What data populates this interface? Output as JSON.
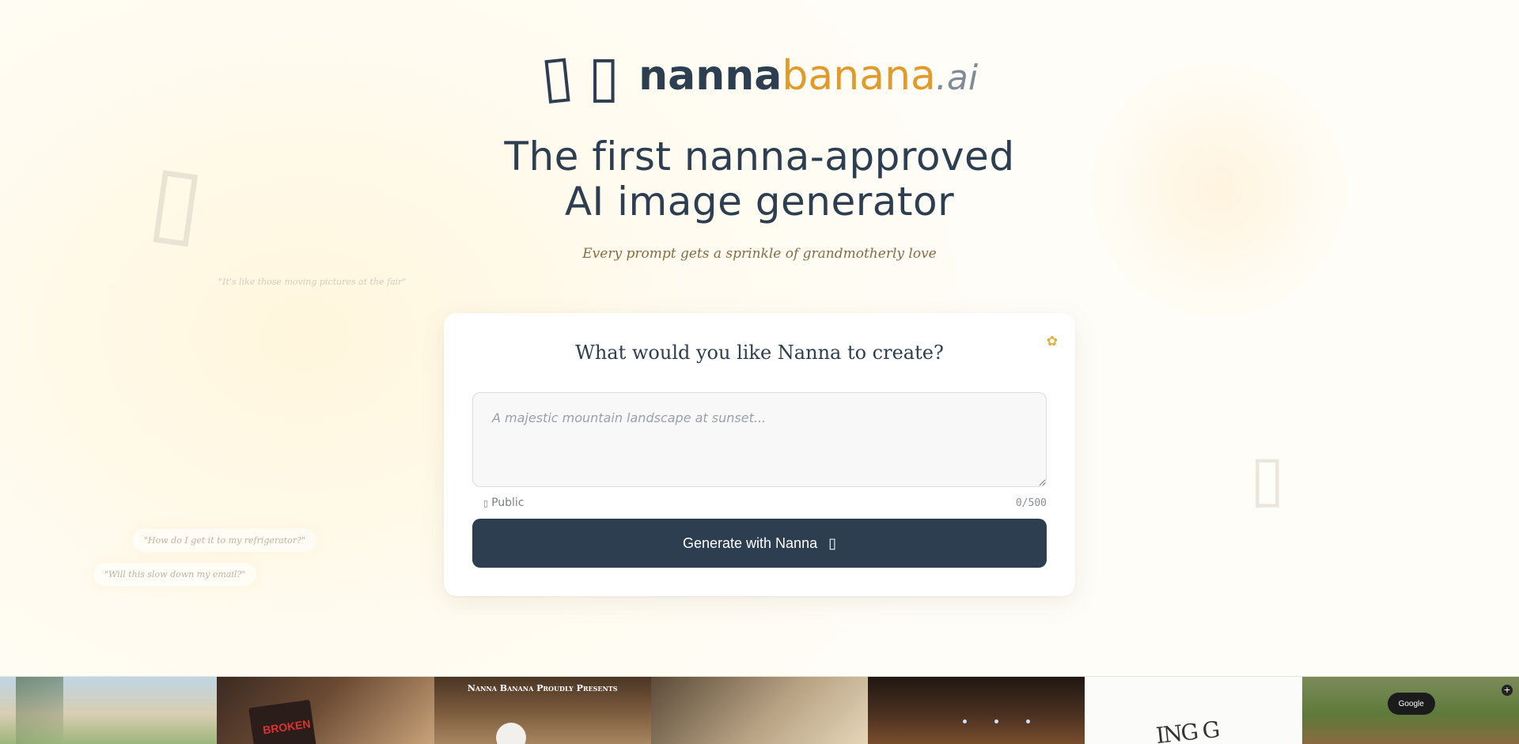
{
  "logo": {
    "icons": [
      "nanna-icon",
      "banana-icon"
    ],
    "icon_glyph": "▯",
    "word_nanna": "nanna",
    "word_banana": "banana",
    "word_ai": ".ai"
  },
  "hero": {
    "headline_line1": "The first nanna-approved",
    "headline_line2": "AI image generator",
    "tagline": "Every prompt gets a sprinkle of grandmotherly love"
  },
  "background_quotes": [
    "\"It's like those moving pictures at the fair\"",
    "\"How do I get it to my refrigerator?\"",
    "\"Will this slow down my email?\""
  ],
  "generator": {
    "title": "What would you like Nanna to create?",
    "sparkle_glyph": "✿",
    "prompt_placeholder": "A majestic mountain landscape at sunset...",
    "prompt_value": "",
    "visibility_icon": "▯",
    "visibility_label": "Public",
    "char_count": "0/500",
    "button_label": "Generate with Nanna",
    "button_icon": "▯"
  },
  "gallery": {
    "tile3_title": "Nanna Banana Proudly Presents",
    "tile2_text": "BROKEN",
    "tile6_text": "ING G",
    "tile7_pill": "Google",
    "tile7_plus": "+"
  },
  "colors": {
    "navy": "#2c3e50",
    "banana": "#e09b2a",
    "button": "#2d3e50",
    "tagline": "#8a6a43"
  }
}
